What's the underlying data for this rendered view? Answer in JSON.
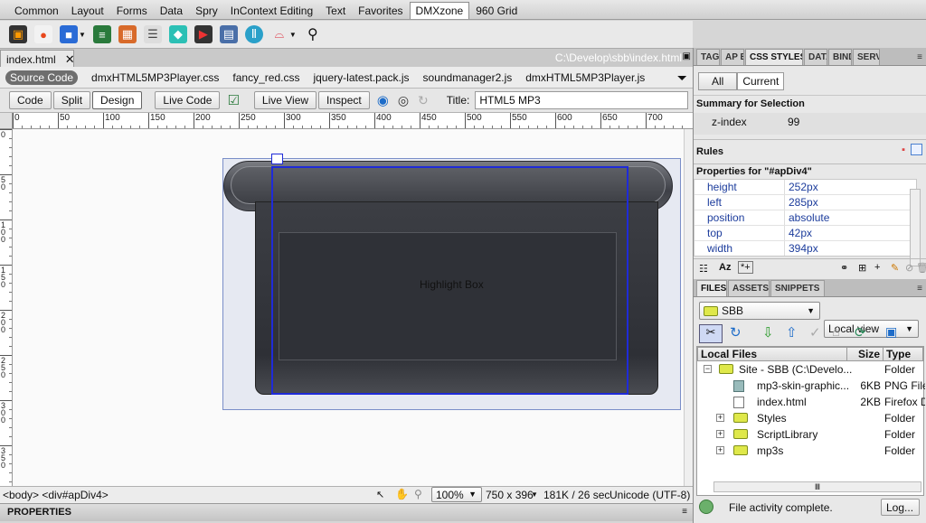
{
  "insert_bar": {
    "tabs": [
      "Common",
      "Layout",
      "Forms",
      "Data",
      "Spry",
      "InContext Editing",
      "Text",
      "Favorites",
      "DMXzone",
      "960 Grid"
    ],
    "active_index": 8
  },
  "document": {
    "tab_label": "index.html",
    "path": "C:\\Develop\\sbb\\index.html",
    "related_files": [
      "Source Code",
      "dmxHTML5MP3Player.css",
      "fancy_red.css",
      "jquery-latest.pack.js",
      "soundmanager2.js",
      "dmxHTML5MP3Player.js"
    ],
    "toolbar": {
      "code": "Code",
      "split": "Split",
      "design": "Design",
      "live_code": "Live Code",
      "live_view": "Live View",
      "inspect": "Inspect",
      "title_label": "Title:",
      "title_value": "HTML5 MP3"
    },
    "ruler_h": [
      "0",
      "50",
      "100",
      "150",
      "200",
      "250",
      "300",
      "350",
      "400",
      "450",
      "500",
      "550",
      "600",
      "650",
      "700"
    ],
    "ruler_v": [
      "0",
      "5 0",
      "1 0 0",
      "1 5 0",
      "2 0 0",
      "2 5 0",
      "3 0 0",
      "3 5 0"
    ],
    "highlight_text": "Highlight Box"
  },
  "status_bar": {
    "tag_selector": "<body> <div#apDiv4>",
    "zoom": "100%",
    "dimensions": "750 x 396",
    "size_time": "181K / 26 sec",
    "encoding": "Unicode (UTF-8)"
  },
  "properties_label": "PROPERTIES",
  "css_panel": {
    "tabs": [
      "TAG",
      "AP E",
      "CSS STYLES",
      "DATA",
      "BIND",
      "SERV"
    ],
    "active_index": 2,
    "mode_all": "All",
    "mode_current": "Current",
    "summary_title": "Summary for Selection",
    "summary": [
      {
        "k": "z-index",
        "v": "99"
      }
    ],
    "rules_title": "Rules",
    "props_title": "Properties for \"#apDiv4\"",
    "props": [
      {
        "k": "height",
        "v": "252px"
      },
      {
        "k": "left",
        "v": "285px"
      },
      {
        "k": "position",
        "v": "absolute"
      },
      {
        "k": "top",
        "v": "42px"
      },
      {
        "k": "width",
        "v": "394px"
      }
    ]
  },
  "files_panel": {
    "tabs": [
      "FILES",
      "ASSETS",
      "SNIPPETS"
    ],
    "active_index": 0,
    "site": "SBB",
    "view": "Local view",
    "col_local": "Local Files",
    "col_size": "Size",
    "col_type": "Type",
    "rows": [
      {
        "name": "Site - SBB (C:\\Develo...",
        "size": "",
        "type": "Folder",
        "kind": "site"
      },
      {
        "name": "mp3-skin-graphic...",
        "size": "6KB",
        "type": "PNG File",
        "kind": "png"
      },
      {
        "name": "index.html",
        "size": "2KB",
        "type": "Firefox D",
        "kind": "html"
      },
      {
        "name": "Styles",
        "size": "",
        "type": "Folder",
        "kind": "folder"
      },
      {
        "name": "ScriptLibrary",
        "size": "",
        "type": "Folder",
        "kind": "folder"
      },
      {
        "name": "mp3s",
        "size": "",
        "type": "Folder",
        "kind": "folder"
      }
    ],
    "status": "File activity complete.",
    "log_button": "Log..."
  },
  "colors": {
    "selection": "#1f2bd8",
    "accent": "#1c3c9c"
  }
}
